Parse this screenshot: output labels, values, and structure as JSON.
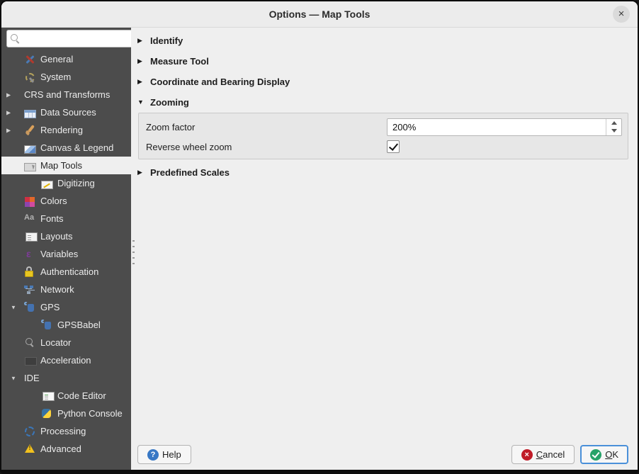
{
  "window": {
    "title": "Options — Map Tools",
    "close_icon": "×"
  },
  "sidebar": {
    "search": {
      "placeholder": "",
      "value": "",
      "icon": "search-icon"
    },
    "items": [
      {
        "label": "General",
        "icon": "general",
        "level": 0,
        "arrow": null,
        "selected": false
      },
      {
        "label": "System",
        "icon": "system",
        "level": 0,
        "arrow": null,
        "selected": false
      },
      {
        "label": "CRS and Transforms",
        "icon": null,
        "level": 0,
        "arrow": "collapsed",
        "selected": false
      },
      {
        "label": "Data Sources",
        "icon": "datasources",
        "level": 0,
        "arrow": "collapsed",
        "selected": false
      },
      {
        "label": "Rendering",
        "icon": "rendering",
        "level": 0,
        "arrow": "collapsed",
        "selected": false
      },
      {
        "label": "Canvas & Legend",
        "icon": "canvas",
        "level": 0,
        "arrow": null,
        "selected": false
      },
      {
        "label": "Map Tools",
        "icon": "maptools",
        "level": 0,
        "arrow": null,
        "selected": true
      },
      {
        "label": "Digitizing",
        "icon": "digitizing",
        "level": 1,
        "arrow": null,
        "selected": false
      },
      {
        "label": "Colors",
        "icon": "colors",
        "level": 0,
        "arrow": null,
        "selected": false
      },
      {
        "label": "Fonts",
        "icon": "fonts",
        "level": 0,
        "arrow": null,
        "selected": false
      },
      {
        "label": "Layouts",
        "icon": "layouts",
        "level": 0,
        "arrow": null,
        "selected": false
      },
      {
        "label": "Variables",
        "icon": "variables",
        "level": 0,
        "arrow": null,
        "selected": false
      },
      {
        "label": "Authentication",
        "icon": "auth",
        "level": 0,
        "arrow": null,
        "selected": false
      },
      {
        "label": "Network",
        "icon": "network",
        "level": 0,
        "arrow": null,
        "selected": false
      },
      {
        "label": "GPS",
        "icon": "gps",
        "level": 0,
        "arrow": "expanded",
        "selected": false
      },
      {
        "label": "GPSBabel",
        "icon": "gps",
        "level": 1,
        "arrow": null,
        "selected": false
      },
      {
        "label": "Locator",
        "icon": "locator",
        "level": 0,
        "arrow": null,
        "selected": false
      },
      {
        "label": "Acceleration",
        "icon": "accel",
        "level": 0,
        "arrow": null,
        "selected": false
      },
      {
        "label": "IDE",
        "icon": null,
        "level": 0,
        "arrow": "expanded",
        "selected": false
      },
      {
        "label": "Code Editor",
        "icon": "codeeditor",
        "level": 1,
        "arrow": null,
        "selected": false
      },
      {
        "label": "Python Console",
        "icon": "python",
        "level": 1,
        "arrow": null,
        "selected": false
      },
      {
        "label": "Processing",
        "icon": "processing",
        "level": 0,
        "arrow": null,
        "selected": false
      },
      {
        "label": "Advanced",
        "icon": "advanced",
        "level": 0,
        "arrow": null,
        "selected": false
      }
    ]
  },
  "main": {
    "sections": [
      {
        "label": "Identify",
        "state": "collapsed"
      },
      {
        "label": "Measure Tool",
        "state": "collapsed"
      },
      {
        "label": "Coordinate and Bearing Display",
        "state": "collapsed"
      },
      {
        "label": "Zooming",
        "state": "expanded"
      },
      {
        "label": "Predefined Scales",
        "state": "collapsed"
      }
    ],
    "zooming": {
      "zoom_factor_label": "Zoom factor",
      "zoom_factor_value": "200%",
      "reverse_wheel_zoom_label": "Reverse wheel zoom",
      "reverse_wheel_zoom_checked": true
    }
  },
  "footer": {
    "help_label": "Help",
    "cancel_mnemonic": "C",
    "cancel_rest": "ancel",
    "ok_mnemonic": "O",
    "ok_rest": "K"
  },
  "colors": {
    "sidebar_bg": "#4c4c4c",
    "selection_bg": "#efefef",
    "dialog_bg": "#efefef",
    "help_icon_blue": "#3878c5",
    "cancel_icon_red": "#c01c28",
    "ok_icon_green": "#26a269",
    "ok_focus_border": "#4a90d9",
    "auth_lock_yellow": "#e8c620",
    "warning_yellow": "#f2c11e"
  }
}
